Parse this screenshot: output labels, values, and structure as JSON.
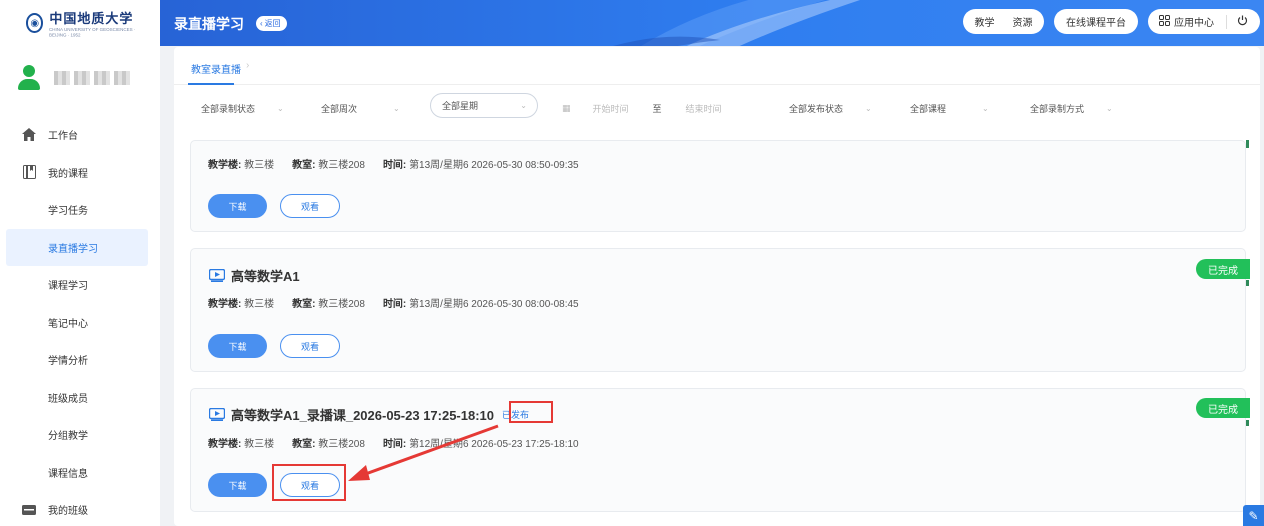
{
  "logo": {
    "name_cn": "中国地质大学",
    "name_en": "CHINA UNIVERSITY OF GEOSCIENCES · BEIJING · 1952"
  },
  "sidebar": {
    "items": [
      {
        "label": "工作台",
        "icon": "home-icon"
      },
      {
        "label": "我的课程",
        "icon": "book-icon"
      },
      {
        "label": "学习任务"
      },
      {
        "label": "录直播学习"
      },
      {
        "label": "课程学习"
      },
      {
        "label": "笔记中心"
      },
      {
        "label": "学情分析"
      },
      {
        "label": "班级成员"
      },
      {
        "label": "分组教学"
      },
      {
        "label": "课程信息"
      },
      {
        "label": "我的班级",
        "icon": "class-icon"
      }
    ]
  },
  "header": {
    "title": "录直播学习",
    "back_label": "返回",
    "teach_label": "教学",
    "resource_label": "资源",
    "online_platform_label": "在线课程平台",
    "app_center_label": "应用中心"
  },
  "tabs": {
    "active_label": "教室录直播"
  },
  "filters": {
    "record_status": "全部录制状态",
    "week_num": "全部周次",
    "weekday": "全部星期",
    "start_time": "开始时间",
    "to": "至",
    "end_time": "结束时间",
    "publish_status": "全部发布状态",
    "course": "全部课程",
    "record_mode": "全部录制方式"
  },
  "cards": [
    {
      "title": "",
      "building_label": "教学楼:",
      "building": "教三楼",
      "room_label": "教室:",
      "room": "教三楼208",
      "time_label": "时间:",
      "time": "第13周/星期6 2026-05-30 08:50-09:35",
      "download_label": "下载",
      "watch_label": "观看"
    },
    {
      "title": "高等数学A1",
      "building_label": "教学楼:",
      "building": "教三楼",
      "room_label": "教室:",
      "room": "教三楼208",
      "time_label": "时间:",
      "time": "第13周/星期6 2026-05-30 08:00-08:45",
      "download_label": "下载",
      "watch_label": "观看",
      "badge": "已完成"
    },
    {
      "title": "高等数学A1_录播课_2026-05-23 17:25-18:10",
      "publish_tag": "已发布",
      "building_label": "教学楼:",
      "building": "教三楼",
      "room_label": "教室:",
      "room": "教三楼208",
      "time_label": "时间:",
      "time": "第12周/星期6 2026-05-23 17:25-18:10",
      "download_label": "下载",
      "watch_label": "观看",
      "badge": "已完成"
    }
  ],
  "colors": {
    "primary": "#2a7ae2",
    "header": "#2f7ef0",
    "success": "#22c05a",
    "highlight": "#e53935"
  }
}
